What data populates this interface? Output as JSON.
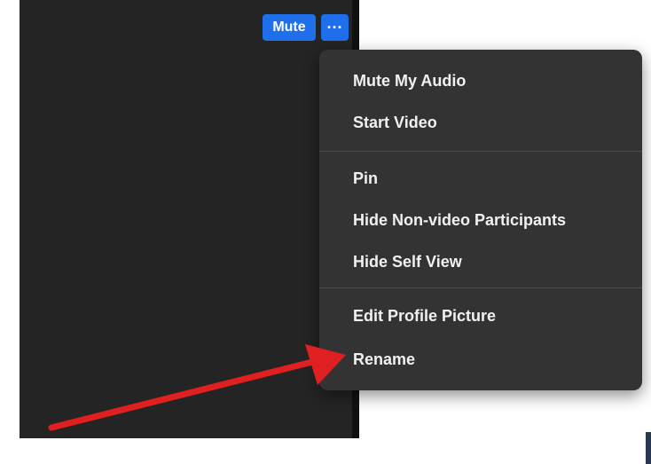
{
  "video_tile": {
    "mute_label": "Mute",
    "more_label": "···"
  },
  "context_menu": {
    "items": [
      {
        "label": "Mute My Audio"
      },
      {
        "label": "Start Video"
      },
      {
        "label": "Pin"
      },
      {
        "label": "Hide Non-video Participants"
      },
      {
        "label": "Hide Self View"
      },
      {
        "label": "Edit Profile Picture"
      },
      {
        "label": "Rename"
      }
    ]
  },
  "colors": {
    "tile_background": "#242424",
    "button_blue": "#1f6feb",
    "menu_background": "#333333",
    "arrow_red": "#e02020"
  }
}
